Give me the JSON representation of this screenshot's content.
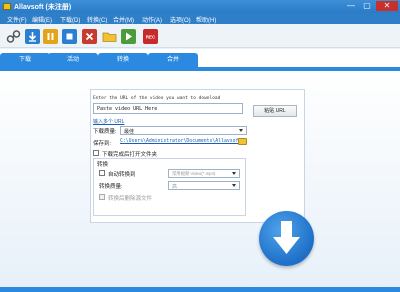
{
  "window": {
    "title": "Allavsoft (未注册)",
    "min_glyph": "—",
    "max_glyph": "▢",
    "close_glyph": "✕"
  },
  "menu": [
    {
      "label": "文件(F)"
    },
    {
      "label": "编辑(E)"
    },
    {
      "label": "下载(D)"
    },
    {
      "label": "转换(C)"
    },
    {
      "label": "合并(M)"
    },
    {
      "label": "动作(A)"
    },
    {
      "label": "选项(O)"
    },
    {
      "label": "帮助(H)"
    }
  ],
  "toolbar": {
    "buttons": [
      {
        "icon": "link-icon"
      },
      {
        "icon": "download-icon"
      },
      {
        "icon": "pause-icon"
      },
      {
        "icon": "stop-icon"
      },
      {
        "icon": "delete-icon"
      },
      {
        "icon": "folder-icon"
      },
      {
        "icon": "play-icon"
      },
      {
        "icon": "record-icon",
        "label": "REC"
      }
    ]
  },
  "tabs": [
    {
      "label": "下载"
    },
    {
      "label": "活动"
    },
    {
      "label": "转换"
    },
    {
      "label": "合并"
    }
  ],
  "download": {
    "instruction": "Enter the URL of the video you want to download",
    "url_value": "Paste video URL Here",
    "paste_button": "粘贴 URL",
    "add_multiple_link": "输入多个 URL",
    "quality_label": "下载质量:",
    "quality_value": "最佳",
    "save_to_label": "保存到:",
    "save_path": "C:\\Users\\Administrator\\Documents\\Allavsoft",
    "open_folder_label": "下载完成后打开文件夹",
    "convert_group_label": "转换",
    "auto_convert_label": "自动转换到",
    "auto_convert_value": "常用视频 Video(*.mp4)",
    "convert_quality_label": "转换质量:",
    "convert_quality_value": "高",
    "delete_original_label": "转换后删除源文件"
  },
  "colors": {
    "accent": "#2b8ae0",
    "titlebar": "#2a7bc8"
  }
}
